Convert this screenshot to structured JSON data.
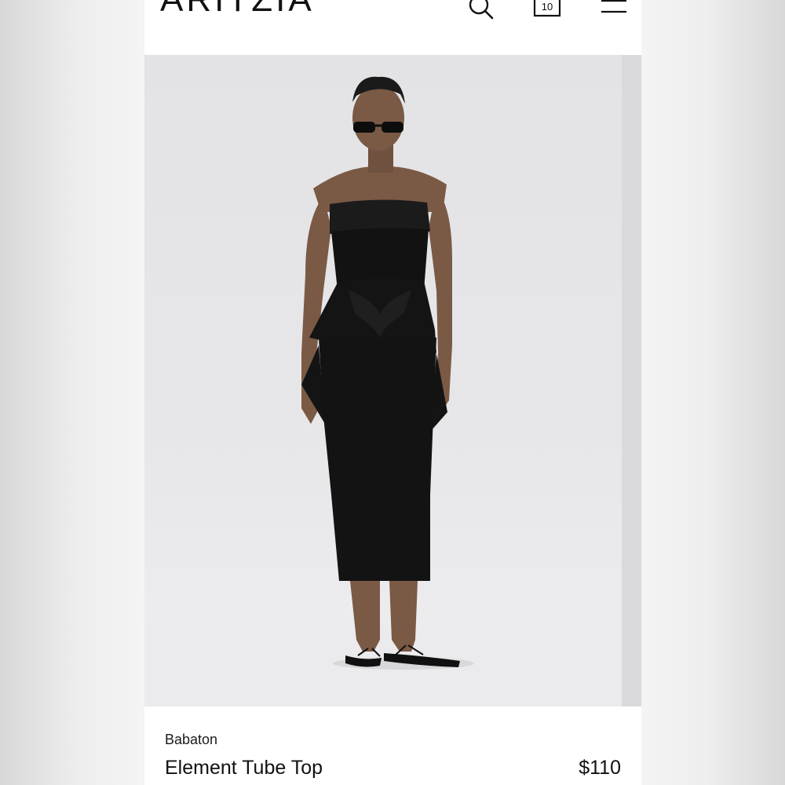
{
  "header": {
    "logo": "ARITZIA",
    "icons": {
      "search": "search-icon",
      "cart": "shopping-bag-icon",
      "menu": "hamburger-menu-icon"
    },
    "cart_count": "10"
  },
  "product": {
    "brand": "Babaton",
    "name": "Element Tube Top",
    "price": "$110"
  },
  "colors": {
    "text": "#111111",
    "image_background": "#e5e5e7"
  }
}
